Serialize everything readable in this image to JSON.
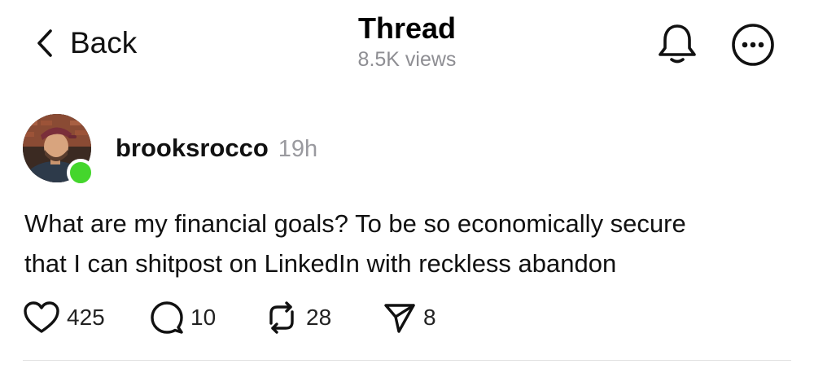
{
  "header": {
    "back_label": "Back",
    "title": "Thread",
    "views": "8.5K views"
  },
  "post": {
    "username": "brooksrocco",
    "timestamp": "19h",
    "online": true,
    "text_lines": [
      "What are my financial goals? To be so economically secure",
      "that I can shitpost on LinkedIn with reckless abandon"
    ]
  },
  "actions": {
    "likes": "425",
    "comments": "10",
    "reposts": "28",
    "shares": "8"
  },
  "icons": {
    "back": "chevron-left-icon",
    "notifications": "bell-icon",
    "more": "more-circle-icon",
    "like": "heart-icon",
    "comment": "comment-icon",
    "repost": "repost-icon",
    "share": "send-icon"
  },
  "colors": {
    "online_indicator": "#44d62c",
    "secondary_text": "#8e8e93",
    "text": "#111111"
  }
}
